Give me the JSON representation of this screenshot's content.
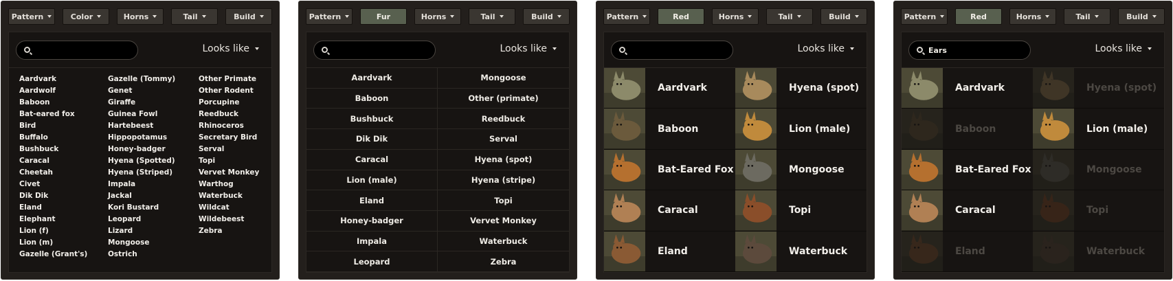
{
  "filters": {
    "pattern": "Pattern",
    "color": "Color",
    "horns": "Horns",
    "tail": "Tail",
    "build": "Build",
    "fur": "Fur",
    "red": "Red"
  },
  "search": {
    "value_panel4": "Ears"
  },
  "looks_like": "Looks like",
  "panel1": {
    "col1": [
      "Aardvark",
      "Aardwolf",
      "Baboon",
      "Bat-eared fox",
      "Bird",
      "Buffalo",
      "Bushbuck",
      "Caracal",
      "Cheetah",
      "Civet",
      "Dik Dik",
      "Eland",
      "Elephant",
      "Lion (f)",
      "Lion (m)",
      "Gazelle (Grant's)"
    ],
    "col2": [
      "Gazelle (Tommy)",
      "Genet",
      "Giraffe",
      "Guinea Fowl",
      "Hartebeest",
      "Hippopotamus",
      "Honey-badger",
      "Hyena (Spotted)",
      "Hyena (Striped)",
      "Impala",
      "Jackal",
      "Kori Bustard",
      "Leopard",
      "Lizard",
      "Mongoose",
      "Ostrich"
    ],
    "col3": [
      "Other Primate",
      "Other Rodent",
      "Porcupine",
      "Reedbuck",
      "Rhinoceros",
      "Secretary Bird",
      "Serval",
      "Topi",
      "Vervet Monkey",
      "Warthog",
      "Waterbuck",
      "Wildcat",
      "Wildebeest",
      "Zebra"
    ]
  },
  "panel2": {
    "left": [
      "Aardvark",
      "Baboon",
      "Bushbuck",
      "Dik Dik",
      "Caracal",
      "Lion (male)",
      "Eland",
      "Honey-badger",
      "Impala",
      "Leopard"
    ],
    "right": [
      "Mongoose",
      "Other (primate)",
      "Reedbuck",
      "Serval",
      "Hyena (spot)",
      "Hyena (stripe)",
      "Topi",
      "Vervet Monkey",
      "Waterbuck",
      "Zebra"
    ]
  },
  "panel3": {
    "left": [
      "Aardvark",
      "Baboon",
      "Bat-Eared Fox",
      "Caracal",
      "Eland"
    ],
    "right": [
      "Hyena (spot)",
      "Lion (male)",
      "Mongoose",
      "Topi",
      "Waterbuck"
    ]
  },
  "panel4": {
    "left": [
      "Aardvark",
      "Baboon",
      "Bat-Eared Fox",
      "Caracal",
      "Eland"
    ],
    "right": [
      "Hyena (spot)",
      "Lion (male)",
      "Mongoose",
      "Topi",
      "Waterbuck"
    ],
    "left_matches": [
      true,
      false,
      true,
      true,
      false
    ],
    "right_matches": [
      false,
      true,
      false,
      false,
      false
    ]
  },
  "thumb_colors": {
    "aardvark": "#8c8a6a",
    "baboon": "#6b5a3c",
    "batfox": "#b5702f",
    "caracal": "#b08054",
    "eland": "#8a5a34",
    "hyena": "#a88a5c",
    "lion": "#c08a3c",
    "mongoose": "#6c6a60",
    "topi": "#8a4e2a",
    "waterbuck": "#5c4a3c"
  }
}
